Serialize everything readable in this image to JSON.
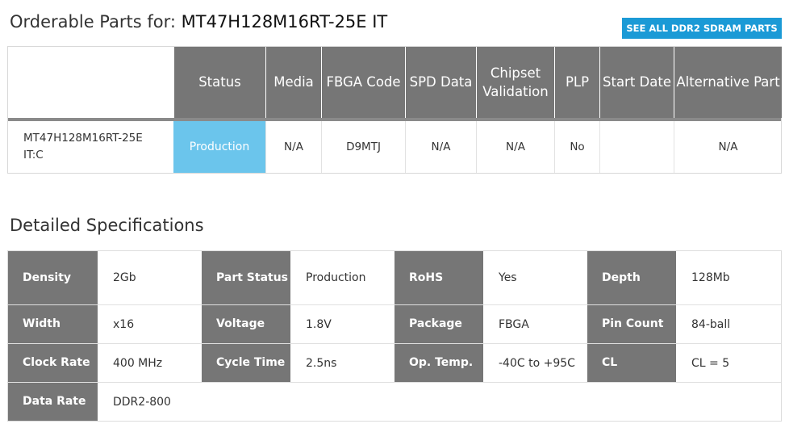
{
  "header": {
    "title_prefix": "Orderable Parts for: ",
    "part_number": "MT47H128M16RT-25E IT",
    "see_all_label": "SEE ALL DDR2 SDRAM PARTS"
  },
  "orderable_table": {
    "columns": [
      "Status",
      "Media",
      "FBGA Code",
      "SPD Data",
      "Chipset Validation",
      "PLP",
      "Start Date",
      "Alternative Part"
    ],
    "rows": [
      {
        "part": "MT47H128M16RT-25E IT:C",
        "status": "Production",
        "media": "N/A",
        "fbga_code": "D9MTJ",
        "spd_data": "N/A",
        "chipset_validation": "N/A",
        "plp": "No",
        "start_date": "",
        "alternative_part": "N/A"
      }
    ]
  },
  "specs": {
    "title": "Detailed Specifications",
    "rows": [
      [
        {
          "label": "Density",
          "value": "2Gb"
        },
        {
          "label": "Part Status",
          "value": "Production"
        },
        {
          "label": "RoHS",
          "value": "Yes"
        },
        {
          "label": "Depth",
          "value": "128Mb"
        }
      ],
      [
        {
          "label": "Width",
          "value": "x16"
        },
        {
          "label": "Voltage",
          "value": "1.8V"
        },
        {
          "label": "Package",
          "value": "FBGA"
        },
        {
          "label": "Pin Count",
          "value": "84-ball"
        }
      ],
      [
        {
          "label": "Clock Rate",
          "value": "400 MHz"
        },
        {
          "label": "Cycle Time",
          "value": "2.5ns"
        },
        {
          "label": "Op. Temp.",
          "value": "-40C to +95C"
        },
        {
          "label": "CL",
          "value": "CL = 5"
        }
      ],
      [
        {
          "label": "Data Rate",
          "value": "DDR2-800"
        }
      ]
    ]
  },
  "colors": {
    "header_gray": "#767676",
    "status_blue": "#6bc5ec",
    "button_blue": "#1b9ad6"
  }
}
